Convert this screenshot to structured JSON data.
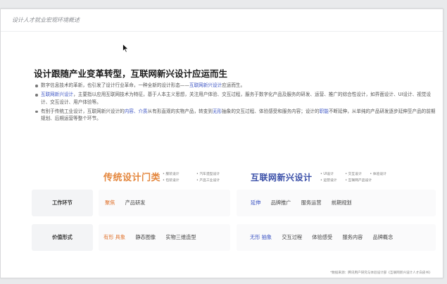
{
  "header": {
    "title": "设计人才就业宏观环境概述"
  },
  "main_title": "设计跟随产业变革转型，互联网新兴设计应运而生",
  "bullets": [
    {
      "pre": "数字信息技术的革新，也引发了设计行业革命，一种全新的设计形态——",
      "hl": "互联网新兴设计",
      "post": "应运而生。"
    },
    {
      "hl": "互联网新兴设计",
      "post": "，主要指以应用互联网技术为特征，基于人本主义思想，关注用户体验、交互过程，服务于数字化产品及服务的研发、运营、推广的综合性设计，如界面设计、UI设计、视觉设计、交互设计、用户体验等。"
    },
    {
      "pre": "有别于传统工业设计，互联网新兴设计的",
      "hl1": "内容、介质",
      "mid1": "从有形直观的实物产品，转变到",
      "hl2": "无形",
      "mid2": "抽象的交互过程、体验感受和服务内容；设计的",
      "hl3": "职能",
      "post": "不断延伸，从单纯的产品研发逐步延伸至产品的前期规划、后期运营等整个环节。"
    }
  ],
  "traditional": {
    "title": "传统设计门类",
    "items": [
      "服装设计",
      "汽车造型设计",
      "包装设计",
      "产品工业设计"
    ]
  },
  "internet": {
    "title": "互联网新兴设计",
    "items": [
      "UI设计",
      "交互设计",
      "体验设计",
      "运营设计",
      "互联网产品设计"
    ]
  },
  "rows": [
    {
      "label": "工作环节",
      "trad_tag": "聚焦",
      "trad_items": [
        "产品研发"
      ],
      "net_tag": "延伸",
      "net_items": [
        "品牌推广",
        "服务运营",
        "前期规划"
      ]
    },
    {
      "label": "价值形式",
      "trad_tag": "有形  具象",
      "trad_items": [
        "静态图像",
        "实物三维造型"
      ],
      "net_tag": "无形  抽象",
      "net_items": [
        "交互过程",
        "体验感受",
        "服务内容",
        "品牌概念"
      ]
    }
  ],
  "footnote": "*数据来源：腾讯用户研究与体验设计部《互联网新兴设计人才白皮书》",
  "colors": {
    "accent_blue": "#3d55c4",
    "accent_orange": "#e0742f"
  }
}
